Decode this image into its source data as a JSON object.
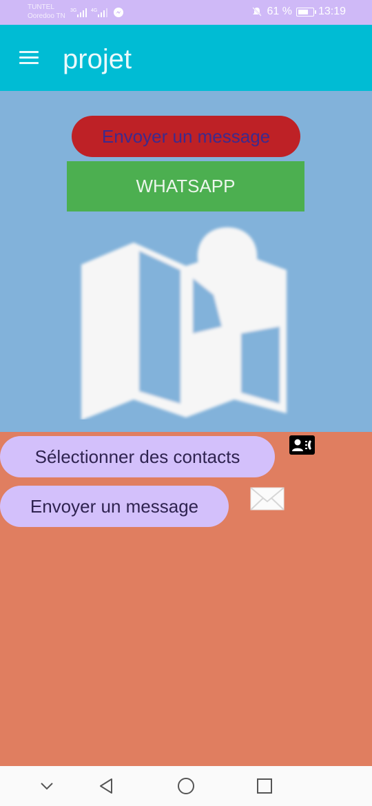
{
  "status_bar": {
    "carrier_line1": "TUNTEL",
    "carrier_line2": "Ooredoo TN",
    "network_1": "3G",
    "network_2": "4G",
    "battery_percent": "61 %",
    "battery_level": 0.61,
    "time": "13:19",
    "icons": [
      "signal-icon",
      "messenger-icon",
      "mute-icon",
      "battery-icon"
    ]
  },
  "app_bar": {
    "title": "projet",
    "menu_icon": "menu-icon",
    "color": "#00bcd4"
  },
  "upper_section": {
    "background": "#82b2da",
    "send_button_label": "Envoyer un message",
    "whatsapp_button_label": "WHATSAPP",
    "image": "map-icon"
  },
  "lower_section": {
    "background": "#e07e60",
    "select_contacts_label": "Sélectionner des contacts",
    "send_message_label": "Envoyer un message",
    "icons": [
      "contacts-icon",
      "mail-icon"
    ]
  },
  "nav_bar": {
    "icons": [
      "collapse-icon",
      "back-icon",
      "home-icon",
      "recents-icon"
    ]
  }
}
